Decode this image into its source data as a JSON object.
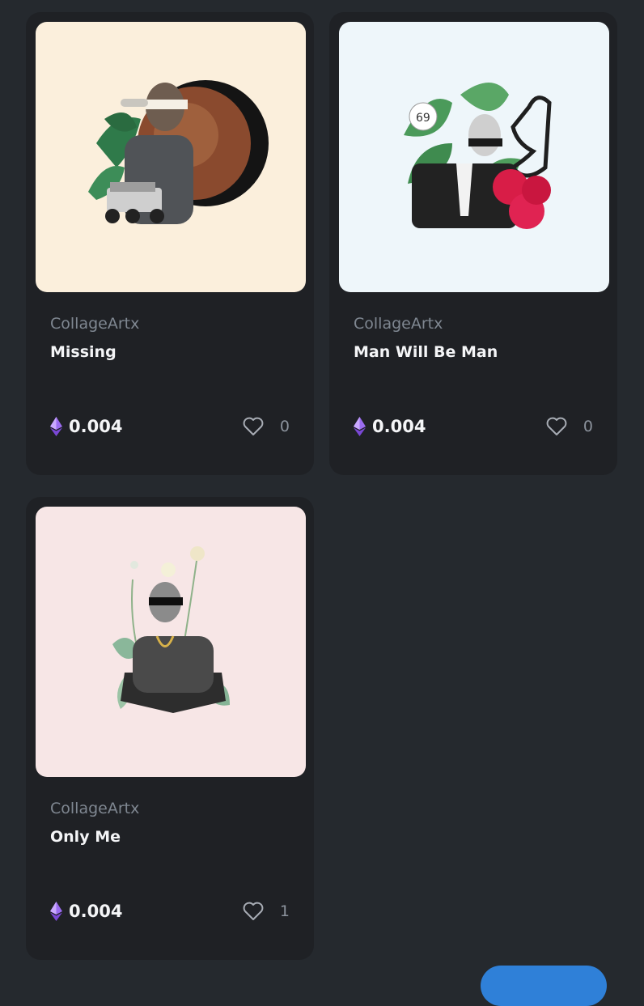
{
  "currency": {
    "icon": "ethereum-icon",
    "color": "#8a5ae0"
  },
  "like_icon": "heart-outline-icon",
  "cards": [
    {
      "creator": "CollageArtx",
      "title": "Missing",
      "price": "0.004",
      "likes": "0",
      "art_bg": "#fbefdc"
    },
    {
      "creator": "CollageArtx",
      "title": "Man Will Be Man",
      "price": "0.004",
      "likes": "0",
      "art_bg": "#eef6fa"
    },
    {
      "creator": "CollageArtx",
      "title": "Only Me",
      "price": "0.004",
      "likes": "1",
      "art_bg": "#f7e6e6"
    }
  ]
}
